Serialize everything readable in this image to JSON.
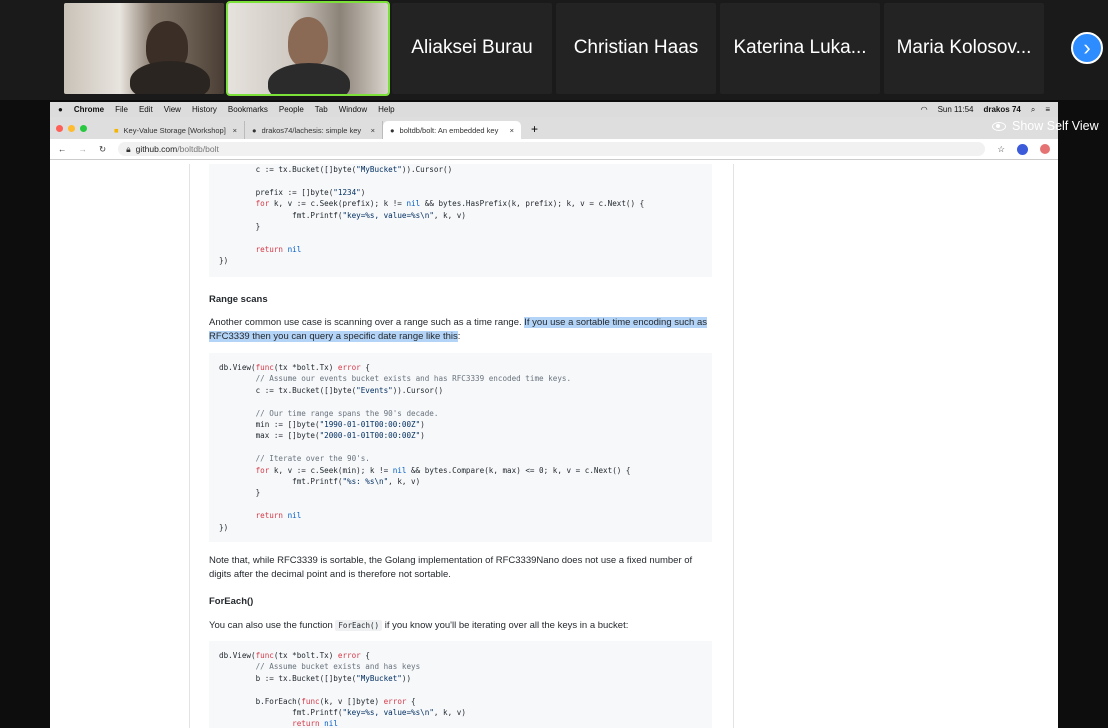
{
  "zoom": {
    "participants": [
      "Aliaksei Burau",
      "Christian Haas",
      "Katerina Luka...",
      "Maria Kolosov..."
    ],
    "next_icon": "chevron-right-icon",
    "show_self_view": "Show Self View",
    "active_border_color": "#7ce23a"
  },
  "mac_menu": {
    "apple": "",
    "app": "Chrome",
    "items": [
      "File",
      "Edit",
      "View",
      "History",
      "Bookmarks",
      "People",
      "Tab",
      "Window",
      "Help"
    ],
    "clock": "Sun 11:54",
    "user": "drakos 74"
  },
  "browser": {
    "tabs": [
      {
        "label": "Key-Value Storage [Workshop]",
        "icon": "doc-icon"
      },
      {
        "label": "drakos74/lachesis: simple key",
        "icon": "github-icon"
      },
      {
        "label": "boltdb/bolt: An embedded key",
        "icon": "github-icon"
      }
    ],
    "new_tab": "+",
    "url_host": "github.com",
    "url_path": "/boltdb/bolt"
  },
  "page": {
    "code1": [
      "\tc := tx.Bucket([]byte(\"MyBucket\")).Cursor()",
      "",
      "\tprefix := []byte(\"1234\")",
      "\tfor k, v := c.Seek(prefix); k != nil && bytes.HasPrefix(k, prefix); k, v = c.Next() {",
      "\t\tfmt.Printf(\"key=%s, value=%s\\n\", k, v)",
      "\t}",
      "",
      "\treturn nil",
      "})"
    ],
    "h_range": "Range scans",
    "p_range_plain": "Another common use case is scanning over a range such as a time range. ",
    "p_range_hl": "If you use a sortable time encoding such as RFC3339 then you can query a specific date range like this",
    "p_range_end": ":",
    "code2": [
      "db.View(func(tx *bolt.Tx) error {",
      "\t// Assume our events bucket exists and has RFC3339 encoded time keys.",
      "\tc := tx.Bucket([]byte(\"Events\")).Cursor()",
      "",
      "\t// Our time range spans the 90's decade.",
      "\tmin := []byte(\"1990-01-01T00:00:00Z\")",
      "\tmax := []byte(\"2000-01-01T00:00:00Z\")",
      "",
      "\t// Iterate over the 90's.",
      "\tfor k, v := c.Seek(min); k != nil && bytes.Compare(k, max) <= 0; k, v = c.Next() {",
      "\t\tfmt.Printf(\"%s: %s\\n\", k, v)",
      "\t}",
      "",
      "\treturn nil",
      "})"
    ],
    "p_note": "Note that, while RFC3339 is sortable, the Golang implementation of RFC3339Nano does not use a fixed number of digits after the decimal point and is therefore not sortable.",
    "h_foreach": "ForEach()",
    "p_foreach_a": "You can also use the function ",
    "p_foreach_code": "ForEach()",
    "p_foreach_b": " if you know you'll be iterating over all the keys in a bucket:",
    "code3": [
      "db.View(func(tx *bolt.Tx) error {",
      "\t// Assume bucket exists and has keys",
      "\tb := tx.Bucket([]byte(\"MyBucket\"))",
      "",
      "\tb.ForEach(func(k, v []byte) error {",
      "\t\tfmt.Printf(\"key=%s, value=%s\\n\", k, v)",
      "\t\treturn nil"
    ]
  }
}
